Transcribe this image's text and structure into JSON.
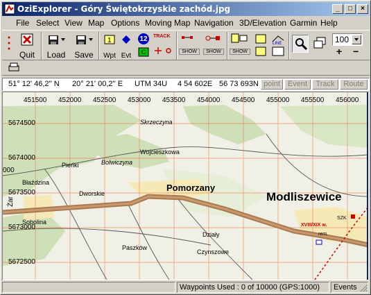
{
  "window": {
    "title": "OziExplorer - Góry Świętokrzyskie zachód.jpg"
  },
  "menu": [
    "File",
    "Select",
    "View",
    "Map",
    "Options",
    "Moving Map",
    "Navigation",
    "3D/Elevation",
    "Garmin",
    "Help"
  ],
  "toolbar": {
    "quit": "Quit",
    "load": "Load",
    "save": "Save",
    "wpt": "Wpt",
    "evt": "Evt",
    "track_label": "TRACK",
    "show1": "SHOW",
    "show2": "SHOW",
    "show3": "SHOW",
    "line": "LINE",
    "num12": "12",
    "zoom_value": "100",
    "zoom_in": "+",
    "zoom_out": "−"
  },
  "coords": {
    "lat": "51° 12' 46,2'' N",
    "lon": "20° 21' 00,2'' E",
    "utm_zone": "UTM  34U",
    "easting": "4 54 602E",
    "northing": "56 73 693N",
    "buttons": [
      "point",
      "Event",
      "Track",
      "Route"
    ]
  },
  "map": {
    "eastings": [
      "451500",
      "452000",
      "452500",
      "453000",
      "453500",
      "454000",
      "454500",
      "455000",
      "455500",
      "456000"
    ],
    "northings": [
      "5674500",
      "5674000",
      "5673500",
      "5673000",
      "5672500"
    ],
    "left_edge": "000",
    "side_label": "Żar",
    "places": [
      {
        "name": "Skrzeczyna",
        "size": "small"
      },
      {
        "name": "Wojcieszkowa",
        "size": "small"
      },
      {
        "name": "Pieńki",
        "size": "small"
      },
      {
        "name": "Bolwiczyna",
        "size": "small"
      },
      {
        "name": "Pomorzany",
        "size": "large"
      },
      {
        "name": "Modliszewice",
        "size": "xlarge"
      },
      {
        "name": "Błaździna",
        "size": "small"
      },
      {
        "name": "Dworskie",
        "size": "small"
      },
      {
        "name": "Sobolina",
        "size": "small"
      },
      {
        "name": "Działy",
        "size": "small"
      },
      {
        "name": "Paszków",
        "size": "small"
      },
      {
        "name": "Czynszowe",
        "size": "small"
      },
      {
        "name": "XVIII/XIX w.",
        "size": "red"
      },
      {
        "name": "rem.",
        "size": "tiny"
      },
      {
        "name": "SZK",
        "size": "tiny"
      }
    ]
  },
  "status": {
    "waypoints": "Waypoints Used : 0 of 10000  (GPS:1000)",
    "events": "Events"
  },
  "colors": {
    "title_start": "#0a246a",
    "title_end": "#a6caf0",
    "road": "#b8865a",
    "grid": "#e87a4a",
    "forest": "#cfe0b8"
  }
}
